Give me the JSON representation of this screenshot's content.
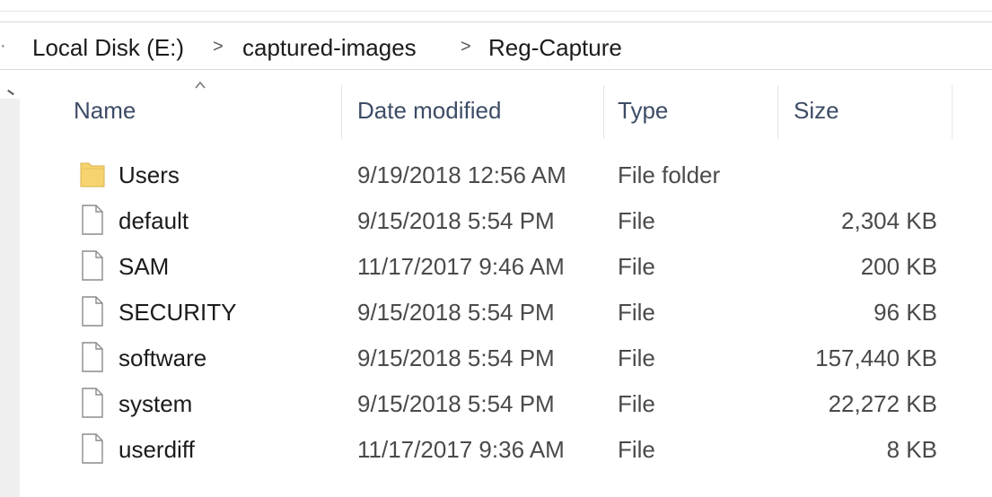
{
  "breadcrumb": {
    "items": [
      "Local Disk (E:)",
      "captured-images",
      "Reg-Capture"
    ],
    "separator": ">"
  },
  "columns": {
    "name": "Name",
    "date": "Date modified",
    "type": "Type",
    "size": "Size"
  },
  "rows": [
    {
      "icon": "folder-icon",
      "name": "Users",
      "date": "9/19/2018 12:56 AM",
      "type": "File folder",
      "size": ""
    },
    {
      "icon": "file-icon",
      "name": "default",
      "date": "9/15/2018 5:54 PM",
      "type": "File",
      "size": "2,304 KB"
    },
    {
      "icon": "file-icon",
      "name": "SAM",
      "date": "11/17/2017 9:46 AM",
      "type": "File",
      "size": "200 KB"
    },
    {
      "icon": "file-icon",
      "name": "SECURITY",
      "date": "9/15/2018 5:54 PM",
      "type": "File",
      "size": "96 KB"
    },
    {
      "icon": "file-icon",
      "name": "software",
      "date": "9/15/2018 5:54 PM",
      "type": "File",
      "size": "157,440 KB"
    },
    {
      "icon": "file-icon",
      "name": "system",
      "date": "9/15/2018 5:54 PM",
      "type": "File",
      "size": "22,272 KB"
    },
    {
      "icon": "file-icon",
      "name": "userdiff",
      "date": "11/17/2017 9:36 AM",
      "type": "File",
      "size": "8 KB"
    }
  ],
  "colors": {
    "folder": "#f6d36e",
    "header_text": "#3d4c66"
  }
}
